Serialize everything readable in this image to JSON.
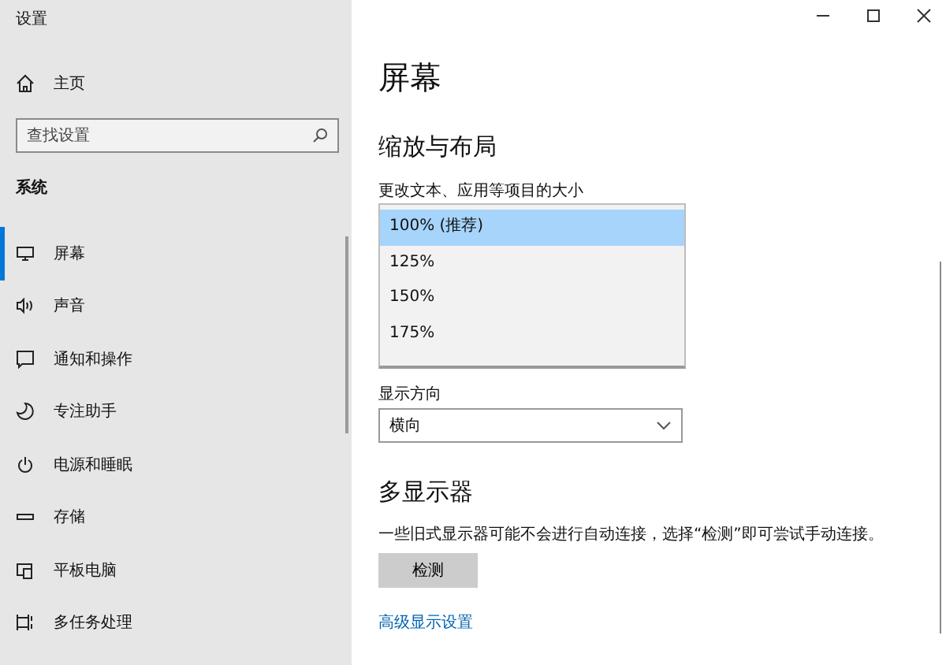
{
  "window": {
    "title": "设置"
  },
  "sidebar": {
    "home": "主页",
    "search": {
      "placeholder": "查找设置"
    },
    "section": "系统",
    "items": [
      {
        "label": "屏幕",
        "selected": true
      },
      {
        "label": "声音",
        "selected": false
      },
      {
        "label": "通知和操作",
        "selected": false
      },
      {
        "label": "专注助手",
        "selected": false
      },
      {
        "label": "电源和睡眠",
        "selected": false
      },
      {
        "label": "存储",
        "selected": false
      },
      {
        "label": "平板电脑",
        "selected": false
      },
      {
        "label": "多任务处理",
        "selected": false
      }
    ]
  },
  "main": {
    "title": "屏幕",
    "scale_section": "缩放与布局",
    "scale_label": "更改文本、应用等项目的大小",
    "scale_options": [
      {
        "label": "100% (推荐)",
        "selected": true
      },
      {
        "label": "125%",
        "selected": false
      },
      {
        "label": "150%",
        "selected": false
      },
      {
        "label": "175%",
        "selected": false
      }
    ],
    "orientation_label": "显示方向",
    "orientation": {
      "value": "横向"
    },
    "multi_section": "多显示器",
    "multi_text": "一些旧式显示器可能不会进行自动连接，选择“检测”即可尝试手动连接。",
    "detect_button": "检测",
    "advanced_link": "高级显示设置"
  }
}
